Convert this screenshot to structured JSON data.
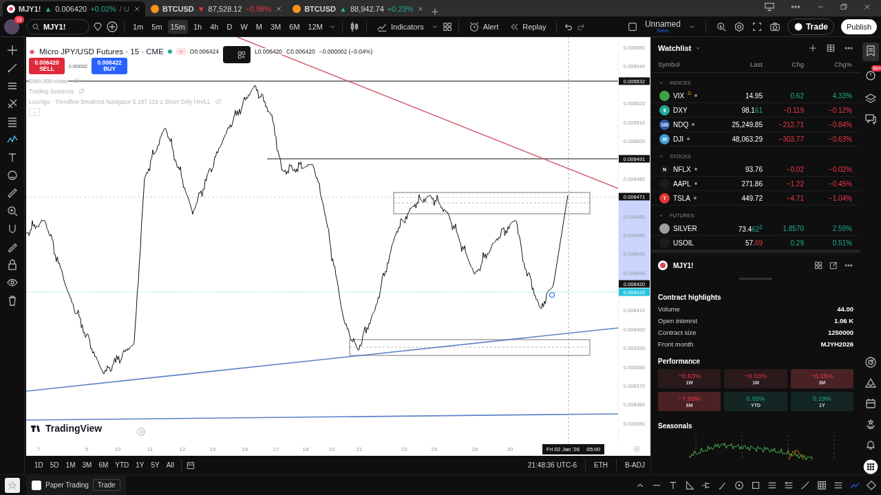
{
  "tabs": [
    {
      "symbol": "MJY1!",
      "arrow": "▲",
      "positive": true,
      "price": "0.006420",
      "change": "+0.02%",
      "suffix": "/ U",
      "selected": true
    },
    {
      "symbol": "BTCUSD",
      "arrow": "▼",
      "positive": false,
      "price": "87,528.12",
      "change": "−0.98%",
      "selected": false
    },
    {
      "symbol": "BTCUSD",
      "arrow": "▲",
      "positive": true,
      "price": "88,942.74",
      "change": "+0.23%",
      "selected": false
    }
  ],
  "avatar_badge": "11",
  "search": {
    "value": "MJY1!"
  },
  "intervals": [
    {
      "label": "1m",
      "selected": false
    },
    {
      "label": "5m",
      "selected": false
    },
    {
      "label": "15m",
      "selected": true
    },
    {
      "label": "1h",
      "selected": false
    },
    {
      "label": "4h",
      "selected": false
    },
    {
      "label": "D",
      "selected": false
    },
    {
      "label": "W",
      "selected": false
    },
    {
      "label": "M",
      "selected": false
    },
    {
      "label": "3M",
      "selected": false
    },
    {
      "label": "6M",
      "selected": false
    },
    {
      "label": "12M",
      "selected": false
    }
  ],
  "toolbar": {
    "indicators": "Indicators",
    "alert": "Alert",
    "replay": "Replay",
    "layout_name": "Unnamed",
    "save": "Save",
    "trade": "Trade",
    "publish": "Publish"
  },
  "legend": {
    "title": "Micro JPY/USD Futures · 15 · CME",
    "ohlc": [
      "O0.006424",
      "L0.006420",
      "C0.006420",
      "−0.000002 (−0.04%)"
    ],
    "sell": {
      "price": "0.006420",
      "label": "SELL"
    },
    "spread": "0.000002",
    "buy": {
      "price": "0.006422",
      "label": "BUY"
    },
    "studies": [
      "EMA 200 close",
      "Trading Sessions",
      "LuxAlgo - Trendline Breakout Navigator 5 197 118 1 Short Only HH/LL"
    ]
  },
  "price_axis": [
    {
      "label": "0.006550",
      "kind": "tick"
    },
    {
      "label": "0.006540",
      "kind": "tick"
    },
    {
      "label": "0.006532",
      "kind": "marker"
    },
    {
      "label": "0.006520",
      "kind": "tick"
    },
    {
      "label": "0.006510",
      "kind": "tick"
    },
    {
      "label": "0.006500",
      "kind": "tick"
    },
    {
      "label": "0.006491",
      "kind": "marker"
    },
    {
      "label": "0.006480",
      "kind": "tick"
    },
    {
      "label": "0.006471",
      "kind": "marker"
    },
    {
      "label": "0.006460",
      "kind": "tick"
    },
    {
      "label": "0.006450",
      "kind": "tick"
    },
    {
      "label": "0.006440",
      "kind": "tick"
    },
    {
      "label": "0.006430",
      "kind": "tick"
    },
    {
      "label": "0.006420",
      "kind": "marker"
    },
    {
      "label": "0.006420",
      "kind": "last"
    },
    {
      "label": "0.006410",
      "kind": "tick"
    },
    {
      "label": "0.006400",
      "kind": "tick"
    },
    {
      "label": "0.006390",
      "kind": "tick"
    },
    {
      "label": "0.006380",
      "kind": "tick"
    },
    {
      "label": "0.006370",
      "kind": "tick"
    },
    {
      "label": "0.006360",
      "kind": "tick"
    },
    {
      "label": "0.006350",
      "kind": "tick"
    }
  ],
  "time_axis": [
    "7",
    "9",
    "10",
    "11",
    "12",
    "15",
    "16",
    "17",
    "18",
    "19",
    "21",
    "23",
    "24",
    "28",
    "30"
  ],
  "crosshair_time": {
    "date": "Fri 02 Jan '26",
    "time": "05:00"
  },
  "watermark": "TradingView",
  "range_buttons": [
    "1D",
    "5D",
    "1M",
    "3M",
    "6M",
    "YTD",
    "1Y",
    "5Y",
    "All"
  ],
  "status": {
    "time": "21:48:36 UTC-6",
    "session": "ETH",
    "adjust": "B-ADJ"
  },
  "watchlist": {
    "title": "Watchlist",
    "columns": [
      "Symbol",
      "Last",
      "Chg",
      "Chg%"
    ],
    "groups": [
      {
        "name": "INDICES",
        "rows": [
          {
            "symbol": "VIX",
            "badge": "D",
            "status_dot": true,
            "color": "#43a047",
            "last": "14.95",
            "positive": true,
            "chg": "0.62",
            "chg_pct": "4.33%"
          },
          {
            "symbol": "DXY",
            "status_dot": false,
            "color": "#26a69a",
            "logo_text": "$",
            "last": "98.1",
            "last_tick": "61",
            "tick_positive": true,
            "positive": false,
            "chg": "−0.119",
            "chg_pct": "−0.12%"
          },
          {
            "symbol": "NDQ",
            "status_dot": true,
            "color": "#2f5aa8",
            "logo_text": "100",
            "last": "25,249.85",
            "positive": false,
            "chg": "−212.71",
            "chg_pct": "−0.84%"
          },
          {
            "symbol": "DJI",
            "status_dot": true,
            "color": "#3d9ad6",
            "logo_text": "30",
            "last": "48,063.29",
            "positive": false,
            "chg": "−303.77",
            "chg_pct": "−0.63%"
          }
        ]
      },
      {
        "name": "STOCKS",
        "rows": [
          {
            "symbol": "NFLX",
            "status_dot": true,
            "color": "#141414",
            "logo_text": "N",
            "last": "93.76",
            "positive": false,
            "chg": "−0.02",
            "chg_pct": "−0.02%"
          },
          {
            "symbol": "AAPL",
            "status_dot": true,
            "color": "#1c1c1c",
            "last": "271.86",
            "positive": false,
            "chg": "−1.22",
            "chg_pct": "−0.45%"
          },
          {
            "symbol": "TSLA",
            "status_dot": true,
            "color": "#e53935",
            "logo_text": "T",
            "last": "449.72",
            "positive": false,
            "chg": "−4.71",
            "chg_pct": "−1.04%"
          }
        ]
      },
      {
        "name": "FUTURES",
        "rows": [
          {
            "symbol": "SILVER",
            "status_dot": false,
            "color": "#9e9e9e",
            "last": "73.4",
            "last_tick": "62$^{2}$",
            "tick_positive": true,
            "positive": true,
            "chg": "1.8570",
            "chg_pct": "2.59%"
          },
          {
            "symbol": "USOIL",
            "status_dot": false,
            "color": "#1c1c1c",
            "last": "57.",
            "last_tick": "69",
            "tick_positive": false,
            "positive": true,
            "chg": "0.29",
            "chg_pct": "0.51%"
          }
        ]
      }
    ]
  },
  "details": {
    "symbol": "MJY1!",
    "section": "Contract highlights",
    "rows": [
      {
        "label": "Volume",
        "value": "44.00"
      },
      {
        "label": "Open interest",
        "value": "1.06 K"
      },
      {
        "label": "Contract size",
        "value": "1250000"
      },
      {
        "label": "Front month",
        "value": "MJYH2026"
      }
    ],
    "performance_title": "Performance",
    "performance": [
      {
        "value": "−0.63%",
        "period": "1W",
        "positive": false,
        "strong": false
      },
      {
        "value": "−0.03%",
        "period": "1M",
        "positive": false,
        "strong": false
      },
      {
        "value": "−6.15%",
        "period": "3M",
        "positive": false,
        "strong": true
      },
      {
        "value": "−7.93%",
        "period": "6M",
        "positive": false,
        "strong": true
      },
      {
        "value": "0.05%",
        "period": "YTD",
        "positive": true,
        "strong": false
      },
      {
        "value": "0.19%",
        "period": "1Y",
        "positive": true,
        "strong": false
      }
    ],
    "seasonals_title": "Seasonals"
  },
  "notification_badge": "99+",
  "paper_trading": {
    "label": "Paper Trading",
    "button": "Trade"
  }
}
